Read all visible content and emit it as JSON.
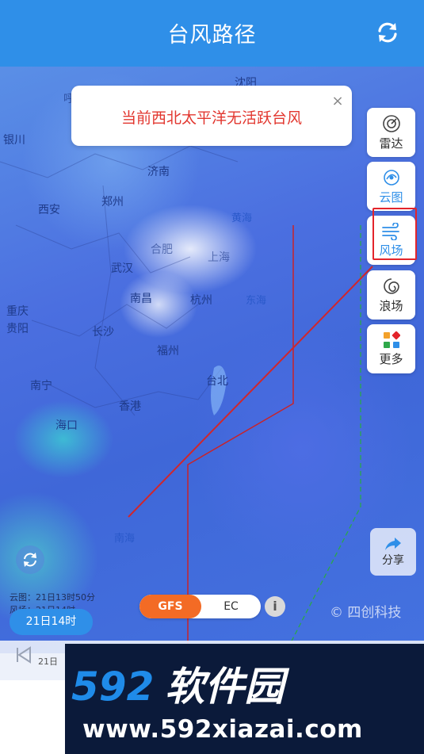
{
  "header": {
    "title": "台风路径",
    "refresh_icon": "refresh-icon"
  },
  "notice": {
    "text": "当前西北太平洋无活跃台风",
    "close_label": "×"
  },
  "map": {
    "cities": [
      {
        "name": "沈阳"
      },
      {
        "name": "银川"
      },
      {
        "name": "呼和浩特"
      },
      {
        "name": "济南"
      },
      {
        "name": "郑州"
      },
      {
        "name": "西安"
      },
      {
        "name": "合肥"
      },
      {
        "name": "武汉"
      },
      {
        "name": "上海"
      },
      {
        "name": "南昌"
      },
      {
        "name": "杭州"
      },
      {
        "name": "重庆"
      },
      {
        "name": "贵阳"
      },
      {
        "name": "长沙"
      },
      {
        "name": "福州"
      },
      {
        "name": "台北"
      },
      {
        "name": "南宁"
      },
      {
        "name": "香港"
      },
      {
        "name": "海口"
      }
    ],
    "seas": [
      "黄海",
      "东海",
      "南海"
    ]
  },
  "tools": [
    {
      "label": "雷达",
      "icon": "radar-icon"
    },
    {
      "label": "云图",
      "icon": "satellite-icon"
    },
    {
      "label": "风场",
      "icon": "wind-icon"
    },
    {
      "label": "浪场",
      "icon": "wave-icon"
    },
    {
      "label": "更多",
      "icon": "more-icon"
    }
  ],
  "share": {
    "label": "分享",
    "icon": "share-icon"
  },
  "cloud_info": {
    "line1": "云图：21日13时50分",
    "line2": "风场：21日14时"
  },
  "model": {
    "gfs": "GFS",
    "ec": "EC",
    "info": "i"
  },
  "watermark": "© 四创科技",
  "time_bubble": "21日14时",
  "timeline": {
    "tick": "21日"
  },
  "promo": {
    "brand_num": "592",
    "brand_cn": "软件园",
    "url": "www.592xiazai.com"
  },
  "colors": {
    "header": "#2f8fe8",
    "notice_text": "#e2372f",
    "gfs_active": "#f36b25",
    "highlight": "#e3242b"
  }
}
